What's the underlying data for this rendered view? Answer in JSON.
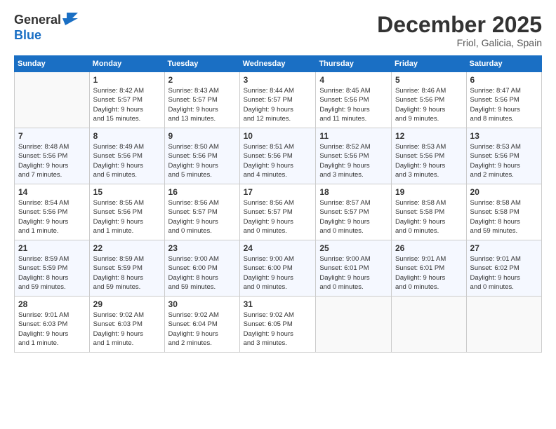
{
  "header": {
    "logo_line1": "General",
    "logo_line2": "Blue",
    "month": "December 2025",
    "location": "Friol, Galicia, Spain"
  },
  "weekdays": [
    "Sunday",
    "Monday",
    "Tuesday",
    "Wednesday",
    "Thursday",
    "Friday",
    "Saturday"
  ],
  "weeks": [
    [
      {
        "day": "",
        "info": ""
      },
      {
        "day": "1",
        "info": "Sunrise: 8:42 AM\nSunset: 5:57 PM\nDaylight: 9 hours\nand 15 minutes."
      },
      {
        "day": "2",
        "info": "Sunrise: 8:43 AM\nSunset: 5:57 PM\nDaylight: 9 hours\nand 13 minutes."
      },
      {
        "day": "3",
        "info": "Sunrise: 8:44 AM\nSunset: 5:57 PM\nDaylight: 9 hours\nand 12 minutes."
      },
      {
        "day": "4",
        "info": "Sunrise: 8:45 AM\nSunset: 5:56 PM\nDaylight: 9 hours\nand 11 minutes."
      },
      {
        "day": "5",
        "info": "Sunrise: 8:46 AM\nSunset: 5:56 PM\nDaylight: 9 hours\nand 9 minutes."
      },
      {
        "day": "6",
        "info": "Sunrise: 8:47 AM\nSunset: 5:56 PM\nDaylight: 9 hours\nand 8 minutes."
      }
    ],
    [
      {
        "day": "7",
        "info": "Sunrise: 8:48 AM\nSunset: 5:56 PM\nDaylight: 9 hours\nand 7 minutes."
      },
      {
        "day": "8",
        "info": "Sunrise: 8:49 AM\nSunset: 5:56 PM\nDaylight: 9 hours\nand 6 minutes."
      },
      {
        "day": "9",
        "info": "Sunrise: 8:50 AM\nSunset: 5:56 PM\nDaylight: 9 hours\nand 5 minutes."
      },
      {
        "day": "10",
        "info": "Sunrise: 8:51 AM\nSunset: 5:56 PM\nDaylight: 9 hours\nand 4 minutes."
      },
      {
        "day": "11",
        "info": "Sunrise: 8:52 AM\nSunset: 5:56 PM\nDaylight: 9 hours\nand 3 minutes."
      },
      {
        "day": "12",
        "info": "Sunrise: 8:53 AM\nSunset: 5:56 PM\nDaylight: 9 hours\nand 3 minutes."
      },
      {
        "day": "13",
        "info": "Sunrise: 8:53 AM\nSunset: 5:56 PM\nDaylight: 9 hours\nand 2 minutes."
      }
    ],
    [
      {
        "day": "14",
        "info": "Sunrise: 8:54 AM\nSunset: 5:56 PM\nDaylight: 9 hours\nand 1 minute."
      },
      {
        "day": "15",
        "info": "Sunrise: 8:55 AM\nSunset: 5:56 PM\nDaylight: 9 hours\nand 1 minute."
      },
      {
        "day": "16",
        "info": "Sunrise: 8:56 AM\nSunset: 5:57 PM\nDaylight: 9 hours\nand 0 minutes."
      },
      {
        "day": "17",
        "info": "Sunrise: 8:56 AM\nSunset: 5:57 PM\nDaylight: 9 hours\nand 0 minutes."
      },
      {
        "day": "18",
        "info": "Sunrise: 8:57 AM\nSunset: 5:57 PM\nDaylight: 9 hours\nand 0 minutes."
      },
      {
        "day": "19",
        "info": "Sunrise: 8:58 AM\nSunset: 5:58 PM\nDaylight: 9 hours\nand 0 minutes."
      },
      {
        "day": "20",
        "info": "Sunrise: 8:58 AM\nSunset: 5:58 PM\nDaylight: 8 hours\nand 59 minutes."
      }
    ],
    [
      {
        "day": "21",
        "info": "Sunrise: 8:59 AM\nSunset: 5:59 PM\nDaylight: 8 hours\nand 59 minutes."
      },
      {
        "day": "22",
        "info": "Sunrise: 8:59 AM\nSunset: 5:59 PM\nDaylight: 8 hours\nand 59 minutes."
      },
      {
        "day": "23",
        "info": "Sunrise: 9:00 AM\nSunset: 6:00 PM\nDaylight: 8 hours\nand 59 minutes."
      },
      {
        "day": "24",
        "info": "Sunrise: 9:00 AM\nSunset: 6:00 PM\nDaylight: 9 hours\nand 0 minutes."
      },
      {
        "day": "25",
        "info": "Sunrise: 9:00 AM\nSunset: 6:01 PM\nDaylight: 9 hours\nand 0 minutes."
      },
      {
        "day": "26",
        "info": "Sunrise: 9:01 AM\nSunset: 6:01 PM\nDaylight: 9 hours\nand 0 minutes."
      },
      {
        "day": "27",
        "info": "Sunrise: 9:01 AM\nSunset: 6:02 PM\nDaylight: 9 hours\nand 0 minutes."
      }
    ],
    [
      {
        "day": "28",
        "info": "Sunrise: 9:01 AM\nSunset: 6:03 PM\nDaylight: 9 hours\nand 1 minute."
      },
      {
        "day": "29",
        "info": "Sunrise: 9:02 AM\nSunset: 6:03 PM\nDaylight: 9 hours\nand 1 minute."
      },
      {
        "day": "30",
        "info": "Sunrise: 9:02 AM\nSunset: 6:04 PM\nDaylight: 9 hours\nand 2 minutes."
      },
      {
        "day": "31",
        "info": "Sunrise: 9:02 AM\nSunset: 6:05 PM\nDaylight: 9 hours\nand 3 minutes."
      },
      {
        "day": "",
        "info": ""
      },
      {
        "day": "",
        "info": ""
      },
      {
        "day": "",
        "info": ""
      }
    ]
  ]
}
